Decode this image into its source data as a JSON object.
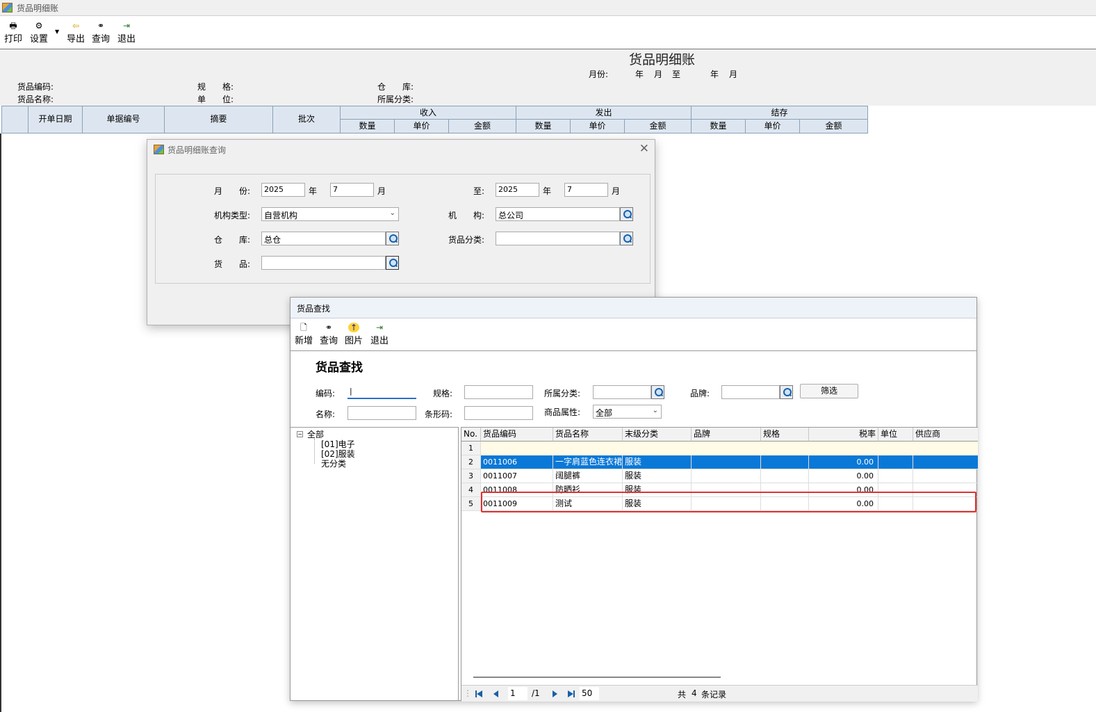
{
  "app": {
    "title": "货品明细账"
  },
  "toolbar": {
    "print": "打印",
    "settings": "设置",
    "export": "导出",
    "query": "查询",
    "exit": "退出"
  },
  "report": {
    "title": "货品明细账",
    "month_label": "月份:",
    "year1": "年",
    "month1": "月",
    "to": "至",
    "year2": "年",
    "month2": "月",
    "code_label": "货品编码:",
    "name_label": "货品名称:",
    "spec_label": "规　　格:",
    "unit_label": "单　　位:",
    "warehouse_label": "仓　　库:",
    "category_label": "所属分类:"
  },
  "grid_head": {
    "date": "开单日期",
    "bill_no": "单据编号",
    "summary": "摘要",
    "batch": "批次",
    "in": "收入",
    "out": "发出",
    "balance": "结存",
    "qty": "数量",
    "price": "单价",
    "amount": "金额"
  },
  "query_dialog": {
    "title": "货品明细账查询",
    "month_label": "月　　份:",
    "year_from": "2025",
    "year_unit": "年",
    "month_from": "7",
    "month_unit": "月",
    "to_label": "至:",
    "year_to": "2025",
    "month_to": "7",
    "org_type_label": "机构类型:",
    "org_type_value": "自营机构",
    "org_label": "机　　构:",
    "org_value": "总公司",
    "warehouse_label": "仓　　库:",
    "warehouse_value": "总仓",
    "category_label": "货品分类:",
    "category_value": "",
    "goods_label": "货　　品:",
    "goods_value": ""
  },
  "search_window": {
    "title": "货品查找",
    "toolbar": {
      "new": "新增",
      "query": "查询",
      "picture": "图片",
      "exit": "退出"
    },
    "heading": "货品查找",
    "filters": {
      "code_label": "编码:",
      "spec_label": "规格:",
      "category_label": "所属分类:",
      "brand_label": "品牌:",
      "filter_button": "筛选",
      "name_label": "名称:",
      "barcode_label": "条形码:",
      "attr_label": "商品属性:",
      "attr_value": "全部"
    },
    "tree": {
      "root": "全部",
      "items": [
        "[01]电子",
        "[02]服装",
        "无分类"
      ]
    },
    "columns": [
      "No.",
      "货品编码",
      "货品名称",
      "末级分类",
      "品牌",
      "规格",
      "税率",
      "单位",
      "供应商"
    ],
    "rows": [
      {
        "no": "1",
        "code": "",
        "name": "",
        "category": "",
        "rate": ""
      },
      {
        "no": "2",
        "code": "0011006",
        "name": "一字肩蓝色连衣裙",
        "category": "服装",
        "rate": "0.00"
      },
      {
        "no": "3",
        "code": "0011007",
        "name": "阔腿裤",
        "category": "服装",
        "rate": "0.00"
      },
      {
        "no": "4",
        "code": "0011008",
        "name": "防晒衫",
        "category": "服装",
        "rate": "0.00"
      },
      {
        "no": "5",
        "code": "0011009",
        "name": "测试",
        "category": "服装",
        "rate": "0.00"
      }
    ],
    "pager": {
      "page": "1",
      "total_pages": "/1",
      "page_size": "50",
      "total_prefix": "共",
      "total_count": "4",
      "total_suffix": "条记录"
    }
  }
}
